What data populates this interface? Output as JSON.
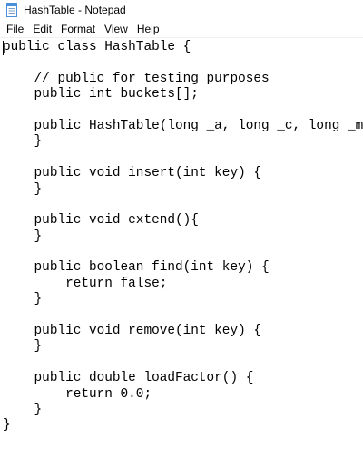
{
  "window": {
    "title": "HashTable - Notepad"
  },
  "menu": {
    "items": [
      "File",
      "Edit",
      "Format",
      "View",
      "Help"
    ]
  },
  "editor": {
    "lines": [
      "public class HashTable {",
      "",
      "    // public for testing purposes",
      "    public int buckets[];",
      "",
      "    public HashTable(long _a, long _c, long _m) {",
      "    }",
      "",
      "    public void insert(int key) {",
      "    }",
      "",
      "    public void extend(){",
      "    }",
      "",
      "    public boolean find(int key) {",
      "        return false;",
      "    }",
      "",
      "    public void remove(int key) {",
      "    }",
      "",
      "    public double loadFactor() {",
      "        return 0.0;",
      "    }",
      "}"
    ]
  },
  "icons": {
    "app": "notepad-icon"
  },
  "colors": {
    "background": "#ffffff",
    "text": "#000000",
    "icon_accent": "#4a90d9"
  }
}
